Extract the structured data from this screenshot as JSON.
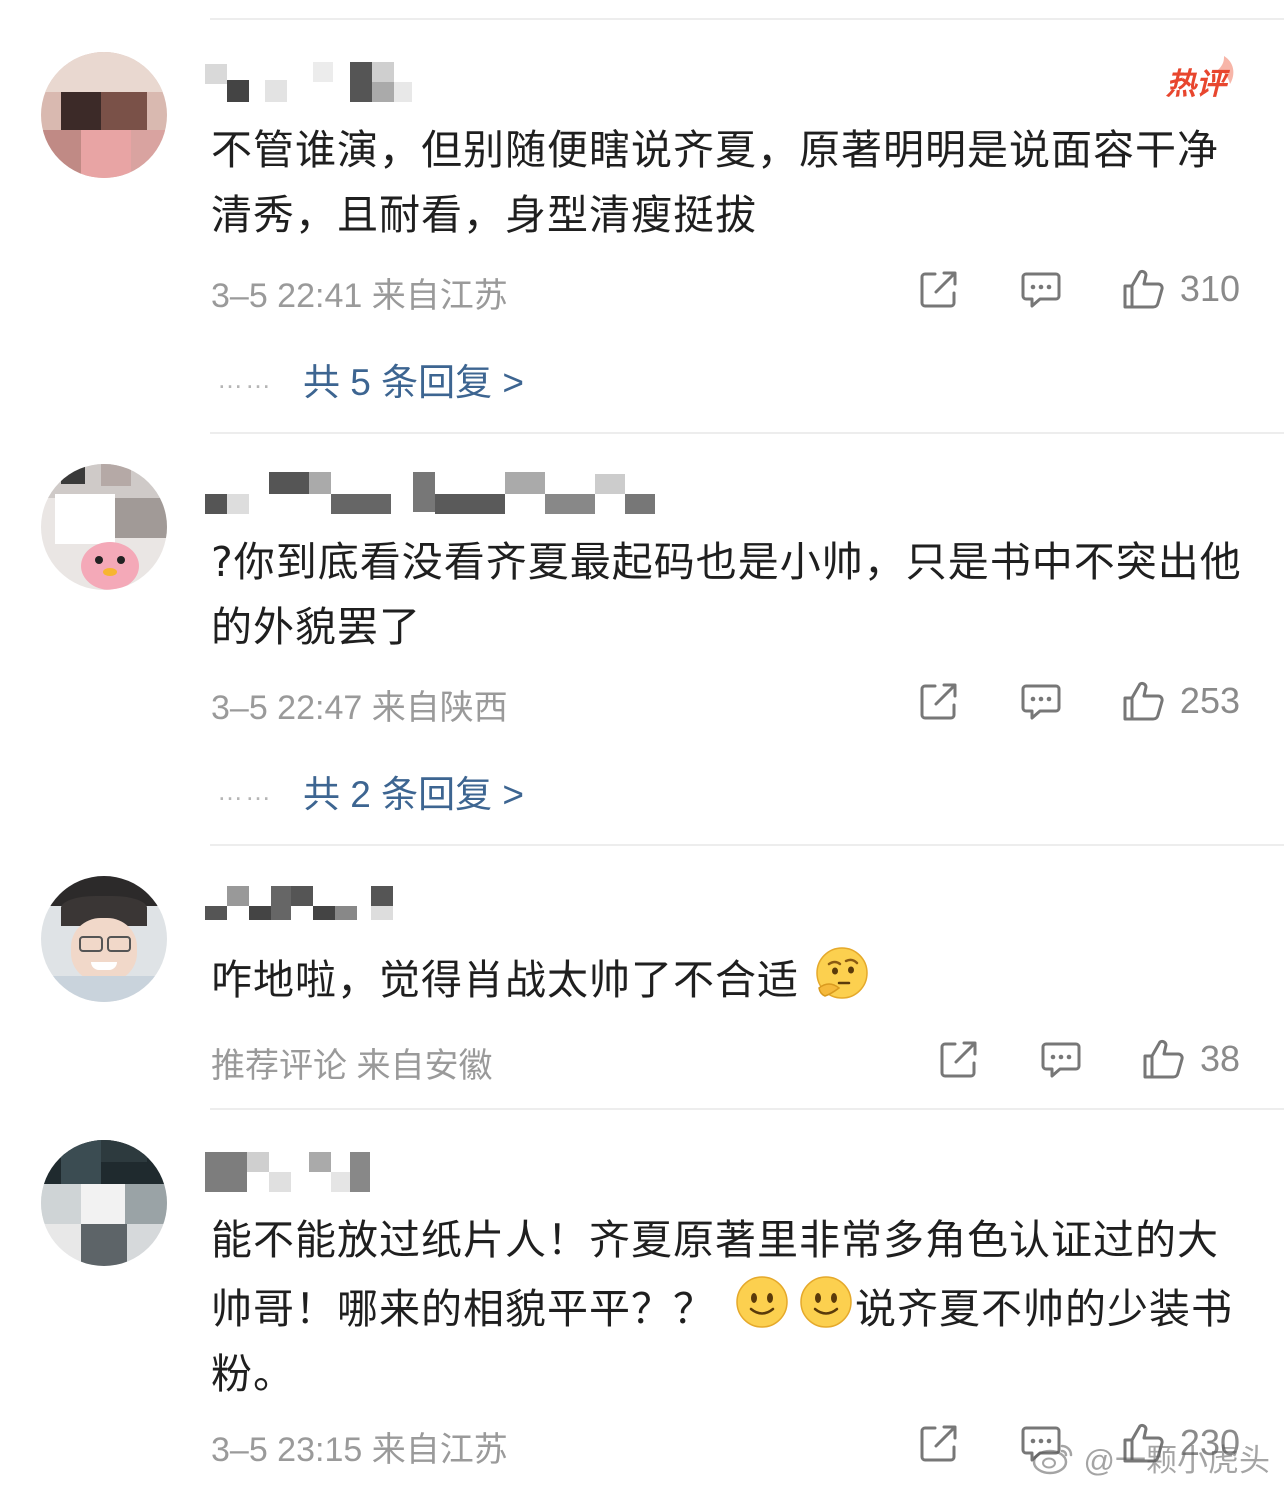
{
  "comments": [
    {
      "text": "不管谁演，但别随便瞎说齐夏，原著明明是说面容干净清秀，且耐看，身型清瘦挺拔",
      "meta": "3–5 22:41  来自江苏",
      "likes": "310",
      "replies": "共 5 条回复 >",
      "badge": "热评"
    },
    {
      "text": "?你到底看没看齐夏最起码也是小帅，只是书中不突出他的外貌罢了",
      "meta": "3–5 22:47  来自陕西",
      "likes": "253",
      "replies": "共 2 条回复 >"
    },
    {
      "text": "咋地啦，觉得肖战太帅了不合适",
      "meta": "推荐评论  来自安徽",
      "likes": "38"
    },
    {
      "text_part1": "能不能放过纸片人！齐夏原著里非常多角色认证过的大帅哥！哪来的相貌平平？？",
      "text_part2": "说齐夏不帅的少装书粉。",
      "meta": "3–5 23:15  来自江苏",
      "likes": "230"
    }
  ],
  "replies_dots": "……",
  "watermark": "@一颗小虎头",
  "icons": {
    "share": "share-icon",
    "comment": "comment-icon",
    "like": "thumbs-up-icon",
    "emoji_thinking": "thinking-emoji-icon",
    "emoji_smile": "smile-emoji-icon",
    "weibo": "weibo-logo-icon"
  },
  "colors": {
    "reply_link": "#3d6591",
    "meta": "#9a9a9a",
    "hot_badge": "#e8462e"
  }
}
